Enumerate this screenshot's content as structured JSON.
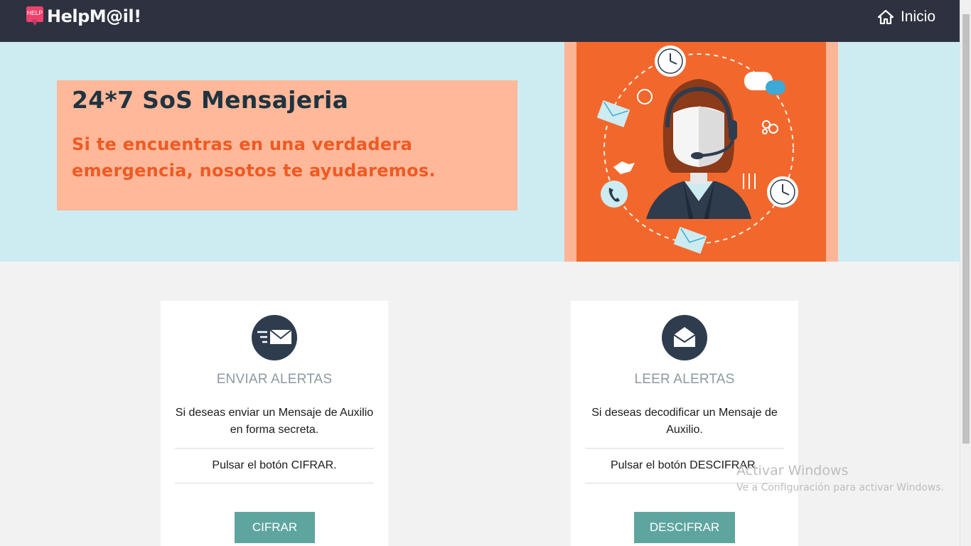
{
  "navbar": {
    "logo_badge": "HELP",
    "brand": "HelpM@il!",
    "home_label": "Inicio"
  },
  "hero": {
    "title": "24*7 SoS Mensajeria",
    "text": "Si te encuentras en una verdadera emergencia, nosotos te ayudaremos."
  },
  "cards": {
    "send": {
      "title": "ENVIAR ALERTAS",
      "description": "Si deseas enviar un Mensaje de Auxilio en forma secreta.",
      "note": "Pulsar el botón CIFRAR.",
      "button": "CIFRAR"
    },
    "read": {
      "title": "LEER ALERTAS",
      "description": "Si deseas decodificar un Mensaje de Auxilio.",
      "note": "Pulsar el botón DESCIFRAR.",
      "button": "DESCIFRAR"
    }
  },
  "watermark": {
    "title": "Activar Windows",
    "subtitle": "Ve a Configuración para activar Windows."
  },
  "colors": {
    "navbar": "#2e3240",
    "hero_bg": "#cdecf1",
    "hero_box": "#ffb899",
    "accent_orange": "#ee5a24",
    "button": "#5ea5a0",
    "icon_circle": "#2e3c4e"
  }
}
